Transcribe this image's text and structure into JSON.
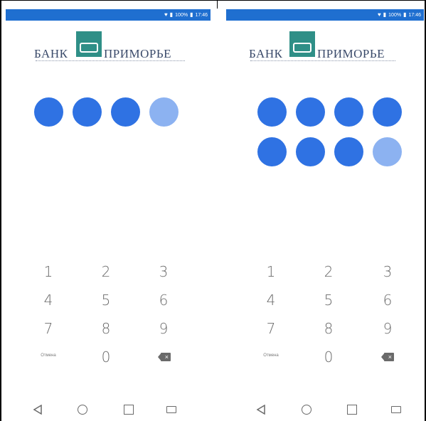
{
  "colors": {
    "status_bar": "#1f6fd0",
    "dot_filled": "#2f72e3",
    "dot_pending": "#8cb2f1",
    "logo_emblem": "#2f8f87",
    "logo_text": "#3a4a6a",
    "key_text": "#6a6a6a"
  },
  "screens": [
    {
      "status_bar": {
        "icons": [
          "heart-icon",
          "signal-icon",
          "battery-icon"
        ],
        "battery_text": "100%",
        "time": "17:46"
      },
      "logo": {
        "left_word": "БАНК",
        "right_word": "ПРИМОРЬЕ"
      },
      "pin": {
        "entered_count": 3,
        "total_count": 4
      },
      "keypad": {
        "rows": [
          [
            "1",
            "2",
            "3"
          ],
          [
            "4",
            "5",
            "6"
          ],
          [
            "7",
            "8",
            "9"
          ]
        ],
        "cancel_label": "Отмена",
        "zero": "0",
        "delete_icon": "backspace-icon"
      },
      "nav_bar": {
        "icons": [
          "back-icon",
          "home-icon",
          "recents-icon",
          "screenshot-icon"
        ]
      }
    },
    {
      "status_bar": {
        "icons": [
          "heart-icon",
          "signal-icon",
          "battery-icon"
        ],
        "battery_text": "100%",
        "time": "17:46"
      },
      "logo": {
        "left_word": "БАНК",
        "right_word": "ПРИМОРЬЕ"
      },
      "pin": {
        "entered_count": 7,
        "total_count": 8
      },
      "keypad": {
        "rows": [
          [
            "1",
            "2",
            "3"
          ],
          [
            "4",
            "5",
            "6"
          ],
          [
            "7",
            "8",
            "9"
          ]
        ],
        "cancel_label": "Отмена",
        "zero": "0",
        "delete_icon": "backspace-icon"
      },
      "nav_bar": {
        "icons": [
          "back-icon",
          "home-icon",
          "recents-icon",
          "screenshot-icon"
        ]
      }
    }
  ]
}
